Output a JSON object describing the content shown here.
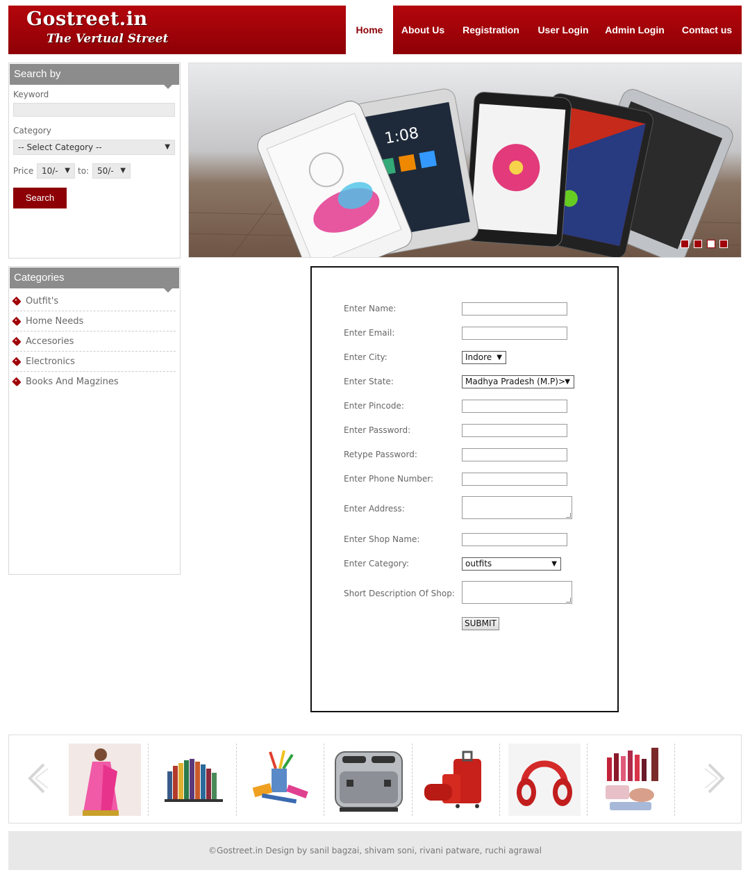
{
  "brand": {
    "name": "Gostreet.in",
    "tagline": "The Vertual Street"
  },
  "nav": {
    "home": "Home",
    "about": "About Us",
    "registration": "Registration",
    "user_login": "User Login",
    "admin_login": "Admin Login",
    "contact": "Contact us",
    "active": "Home"
  },
  "search": {
    "title": "Search by",
    "keyword_label": "Keyword",
    "keyword_value": "",
    "category_label": "Category",
    "category_selected": "-- Select Category --",
    "price_label": "Price",
    "price_from": "10/-",
    "to_label": "to:",
    "price_to": "50/-",
    "button": "Search"
  },
  "categories": {
    "title": "Categories",
    "items": [
      "Outfit's",
      "Home Needs",
      "Accesories",
      "Electronics",
      "Books And Magzines"
    ]
  },
  "banner": {
    "slides": 4,
    "active_slide": 3
  },
  "form": {
    "name_label": "Enter Name:",
    "email_label": "Enter Email:",
    "city_label": "Enter City:",
    "city_selected": "Indore",
    "state_label": "Enter State:",
    "state_selected": "Madhya Pradesh (M.P)>",
    "pincode_label": "Enter Pincode:",
    "password_label": "Enter Password:",
    "retype_label": "Retype Password:",
    "phone_label": "Enter Phone Number:",
    "address_label": "Enter Address:",
    "shop_label": "Enter Shop Name:",
    "category_label": "Enter Category:",
    "category_selected": "outfits",
    "desc_label": "Short Description Of Shop:",
    "submit": "SUBMIT"
  },
  "carousel": {
    "items": [
      "saree-product-image",
      "books-product-image",
      "stationery-product-image",
      "toaster-product-image",
      "luggage-product-image",
      "headphones-product-image",
      "cosmetics-product-image"
    ]
  },
  "footer": {
    "text": "©Gostreet.in Design by sanil bagzai, shivam soni, rivani patware, ruchi agrawal"
  },
  "colors": {
    "brand_red": "#a00008",
    "panel_head": "#8c8c8c",
    "footer_bg": "#e8e8e8"
  }
}
